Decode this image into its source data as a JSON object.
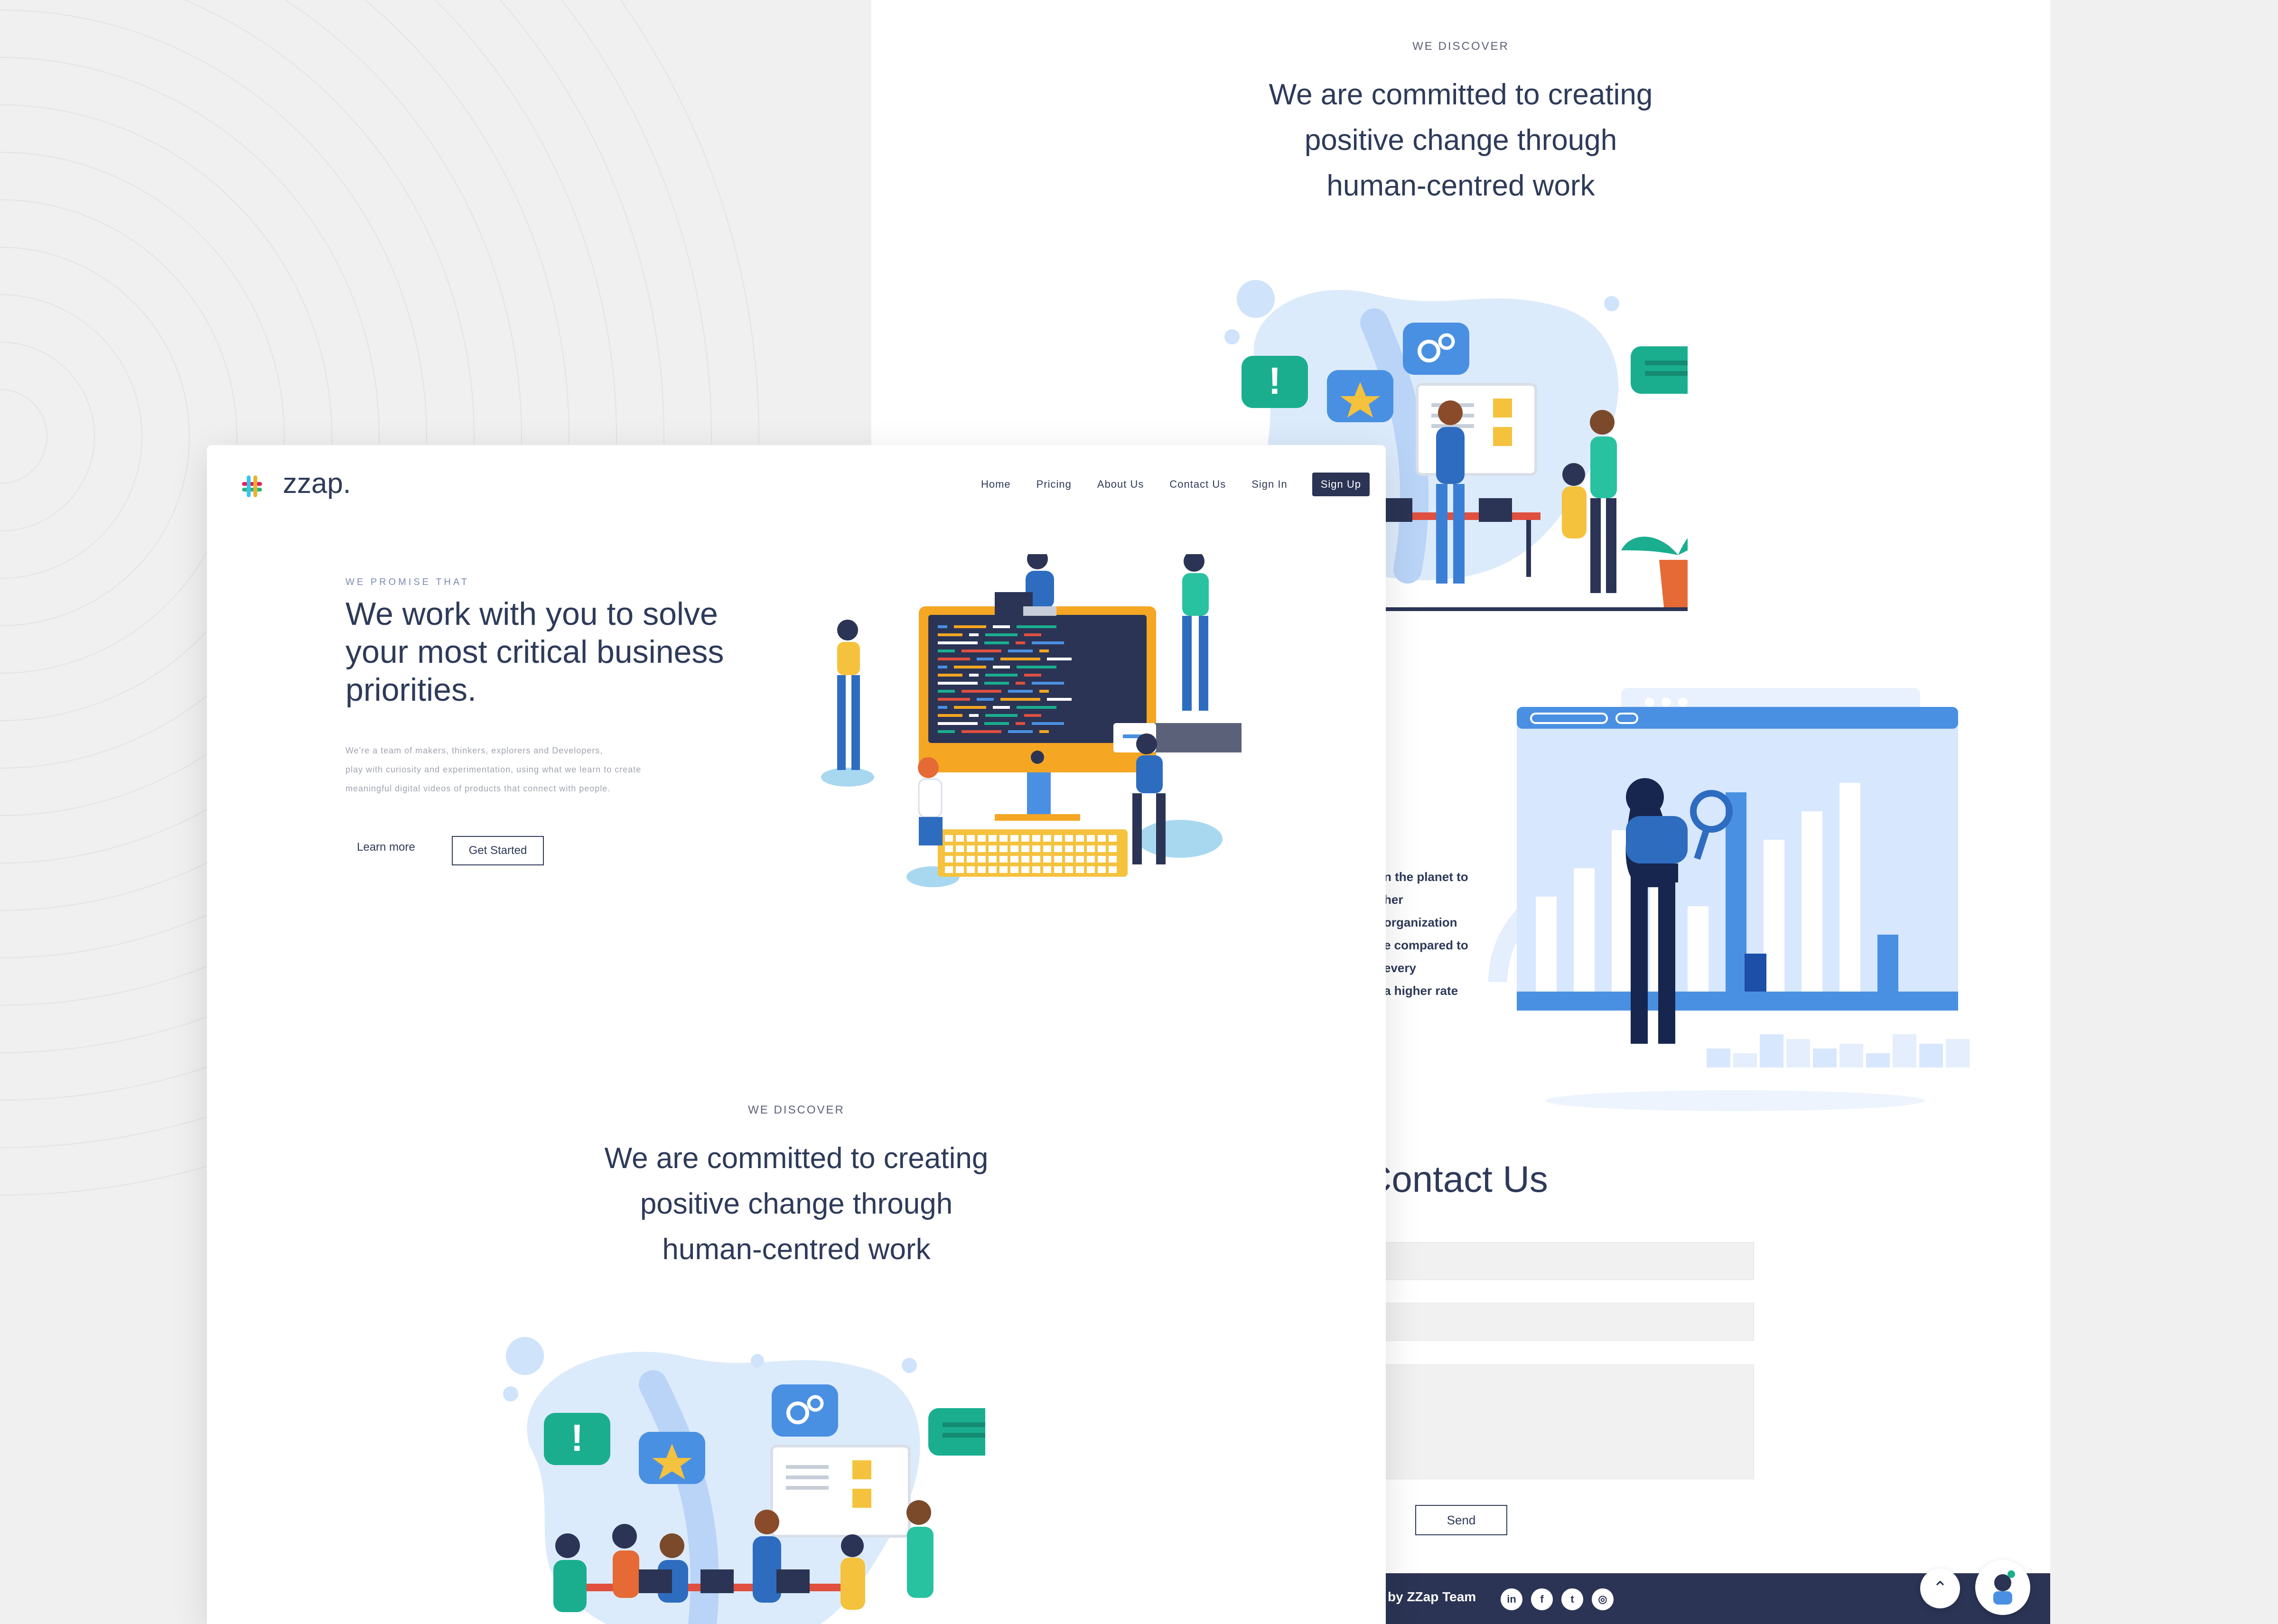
{
  "brand": {
    "name": "zzap."
  },
  "nav": {
    "items": [
      "Home",
      "Pricing",
      "About Us",
      "Contact Us",
      "Sign In"
    ],
    "signup_label": "Sign Up"
  },
  "hero": {
    "eyebrow": "WE PROMISE THAT",
    "heading": "We work with you to solve your most critical business priorities.",
    "description_lines": [
      "We're a team of makers, thinkers, explorers and Developers,",
      "play with curiosity and experimentation, using what we learn to create",
      "meaningful digital videos of products that connect with people."
    ],
    "learn_more": "Learn more",
    "get_started": "Get Started"
  },
  "discover": {
    "eyebrow": "WE DISCOVER",
    "heading_lines": [
      "We are committed to creating",
      "positive change through",
      "human-centred work"
    ]
  },
  "stats_partial_lines": [
    "n the planet to",
    "her",
    "organization",
    "e compared to",
    "every",
    "a higher rate"
  ],
  "contact": {
    "title": "Contact Us",
    "send_label": "Send"
  },
  "footer": {
    "credit": "by ZZap Team",
    "social_icons": [
      "linkedin-icon",
      "facebook-icon",
      "twitter-icon",
      "instagram-icon"
    ]
  },
  "colors": {
    "navy": "#2b3454",
    "text": "#2e3a59",
    "accent_blue": "#4a90e2",
    "teal": "#1aae8f",
    "orange": "#f5a623"
  }
}
